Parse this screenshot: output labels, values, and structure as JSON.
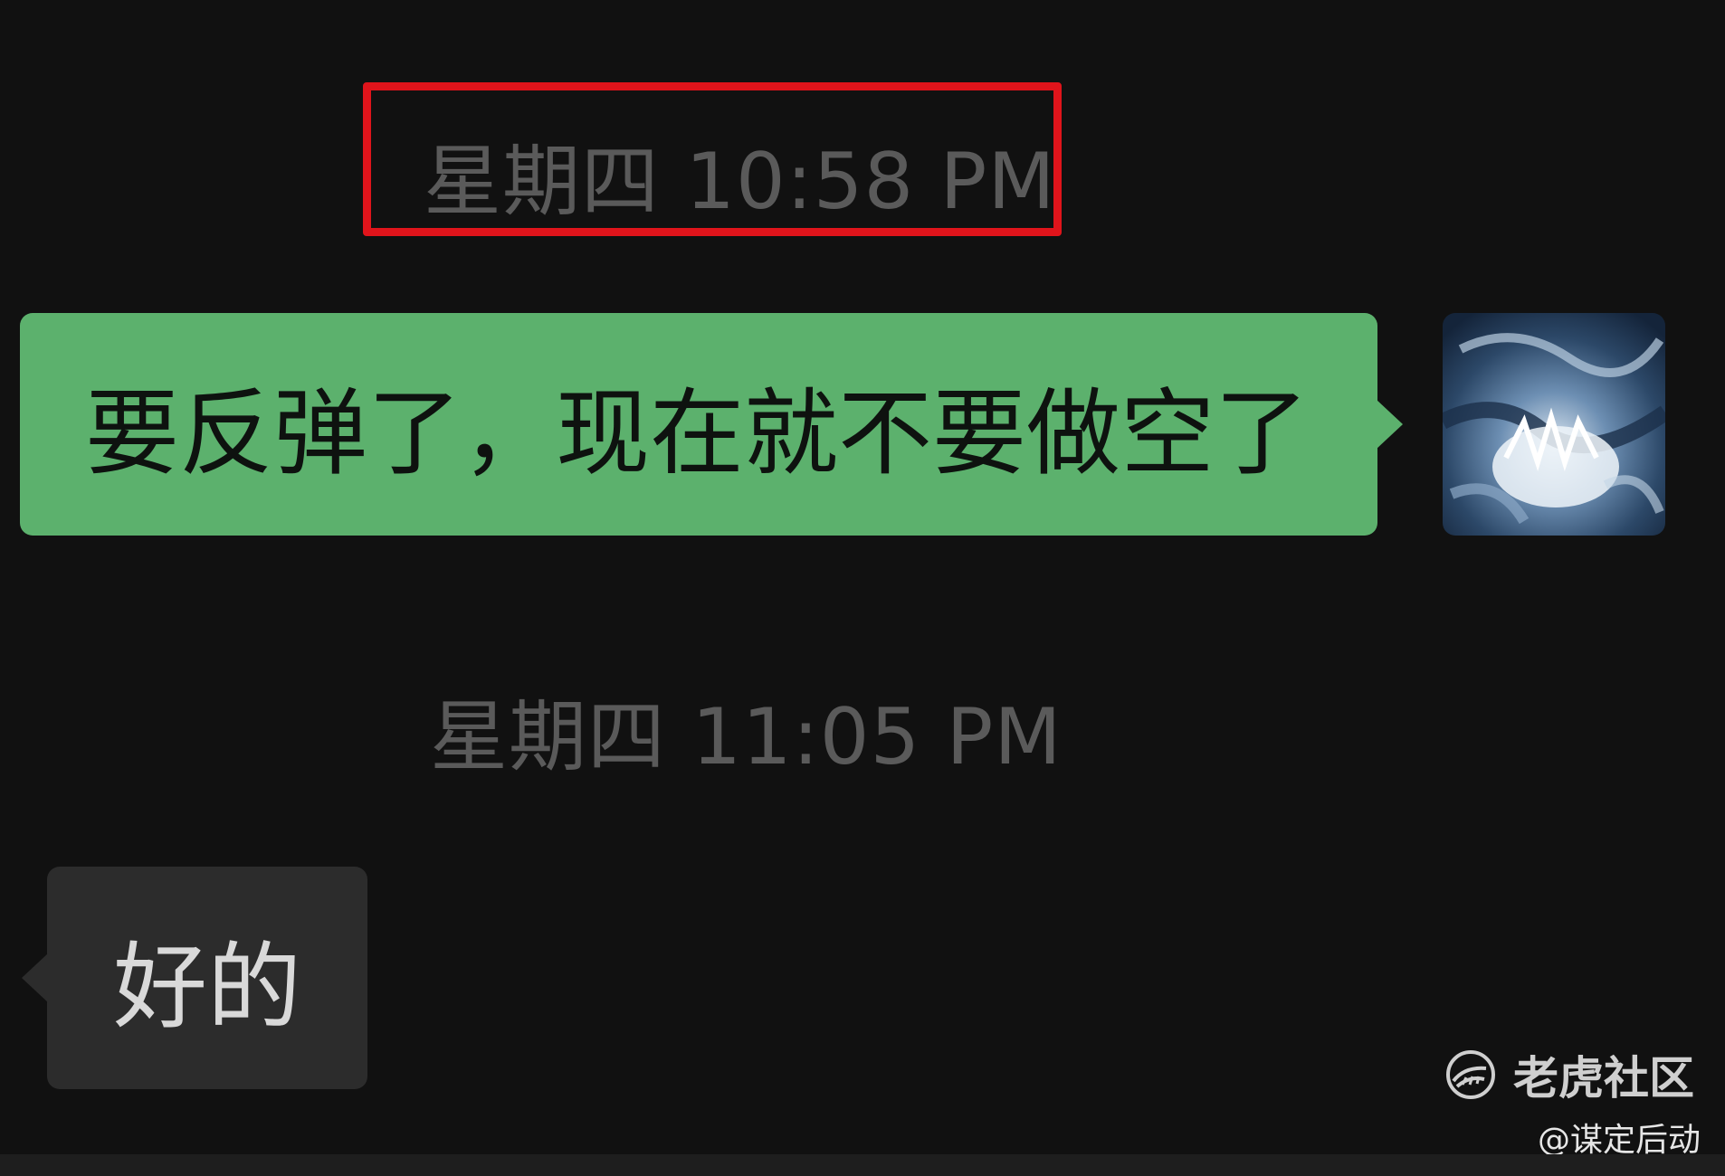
{
  "conversation": {
    "messages": [
      {
        "type": "timestamp",
        "text": "星期四 10:58 PM",
        "highlighted": true
      },
      {
        "type": "outgoing",
        "text": "要反弹了，现在就不要做空了"
      },
      {
        "type": "timestamp",
        "text": "星期四 11:05 PM"
      },
      {
        "type": "incoming",
        "text": "好的"
      }
    ]
  },
  "watermark": {
    "brand": "老虎社区",
    "credit": "@谋定后动",
    "icon": "tiger-logo-icon"
  },
  "colors": {
    "background": "#111111",
    "outgoing_bubble": "#5cb16d",
    "incoming_bubble": "#2c2c2c",
    "timestamp_text": "#5a5a5a",
    "highlight_border": "#e0141b"
  }
}
